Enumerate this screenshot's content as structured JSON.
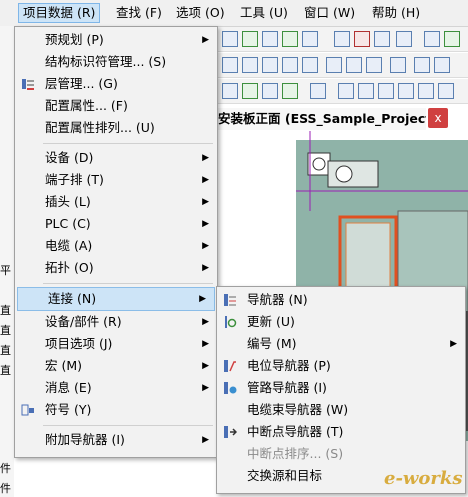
{
  "menubar": {
    "items": [
      "项目数据 (R)",
      "查找 (F)",
      "选项 (O)",
      "工具 (U)",
      "窗口 (W)",
      "帮助 (H)"
    ]
  },
  "tab": {
    "title": "安装板正面 (ESS_Sample_Project)",
    "close": "x"
  },
  "left_fragments": [
    "平",
    "直",
    "直",
    "直",
    "直",
    "件",
    "件"
  ],
  "menu": {
    "items": [
      {
        "label": "预规划 (P)"
      },
      {
        "label": "结构标识符管理... (S)"
      },
      {
        "label": "层管理... (G)"
      },
      {
        "label": "配置属性... (F)"
      },
      {
        "label": "配置属性排列... (U)"
      },
      {
        "label": "设备 (D)"
      },
      {
        "label": "端子排 (T)"
      },
      {
        "label": "插头 (L)"
      },
      {
        "label": "PLC (C)"
      },
      {
        "label": "电缆 (A)"
      },
      {
        "label": "拓扑 (O)"
      },
      {
        "label": "连接 (N)"
      },
      {
        "label": "设备/部件 (R)"
      },
      {
        "label": "项目选项 (J)"
      },
      {
        "label": "宏 (M)"
      },
      {
        "label": "消息 (E)"
      },
      {
        "label": "符号 (Y)"
      },
      {
        "label": "附加导航器 (I)"
      }
    ]
  },
  "submenu": {
    "items": [
      {
        "label": "导航器 (N)"
      },
      {
        "label": "更新 (U)"
      },
      {
        "label": "编号 (M)"
      },
      {
        "label": "电位导航器 (P)"
      },
      {
        "label": "管路导航器 (I)"
      },
      {
        "label": "电缆束导航器 (W)"
      },
      {
        "label": "中断点导航器 (T)"
      },
      {
        "label": "中断点排序... (S)"
      },
      {
        "label": "交换源和目标"
      }
    ]
  },
  "watermark": {
    "text": "e-works"
  },
  "colors": {
    "highlight": "#cde4f7",
    "panel": "#8fb3a8",
    "accent_line": "#e05020"
  }
}
